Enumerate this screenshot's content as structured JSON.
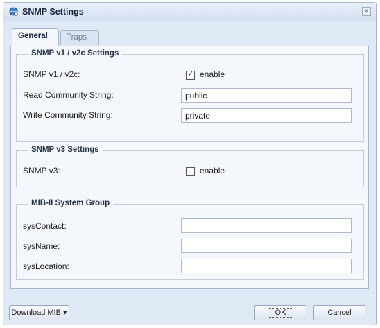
{
  "window": {
    "title": "SNMP Settings",
    "icon": "globe-settings-icon",
    "close_glyph": "×"
  },
  "tabs": [
    {
      "label": "General",
      "active": true
    },
    {
      "label": "Traps",
      "active": false
    }
  ],
  "snmp_v1v2c": {
    "legend": "SNMP v1 / v2c Settings",
    "enable_label": "SNMP v1 / v2c:",
    "enable_checkbox_text": "enable",
    "enabled": true,
    "read_label": "Read Community String:",
    "read_value": "public",
    "write_label": "Write Community String:",
    "write_value": "private"
  },
  "snmp_v3": {
    "legend": "SNMP v3 Settings",
    "enable_label": "SNMP v3:",
    "enable_checkbox_text": "enable",
    "enabled": false
  },
  "mib2": {
    "legend": "MIB-II System Group",
    "contact_label": "sysContact:",
    "contact_value": "",
    "name_label": "sysName:",
    "name_value": "",
    "location_label": "sysLocation:",
    "location_value": ""
  },
  "footer": {
    "download_label": "Download MIB",
    "download_arrow": "▾",
    "ok_label": "OK",
    "cancel_label": "Cancel"
  }
}
